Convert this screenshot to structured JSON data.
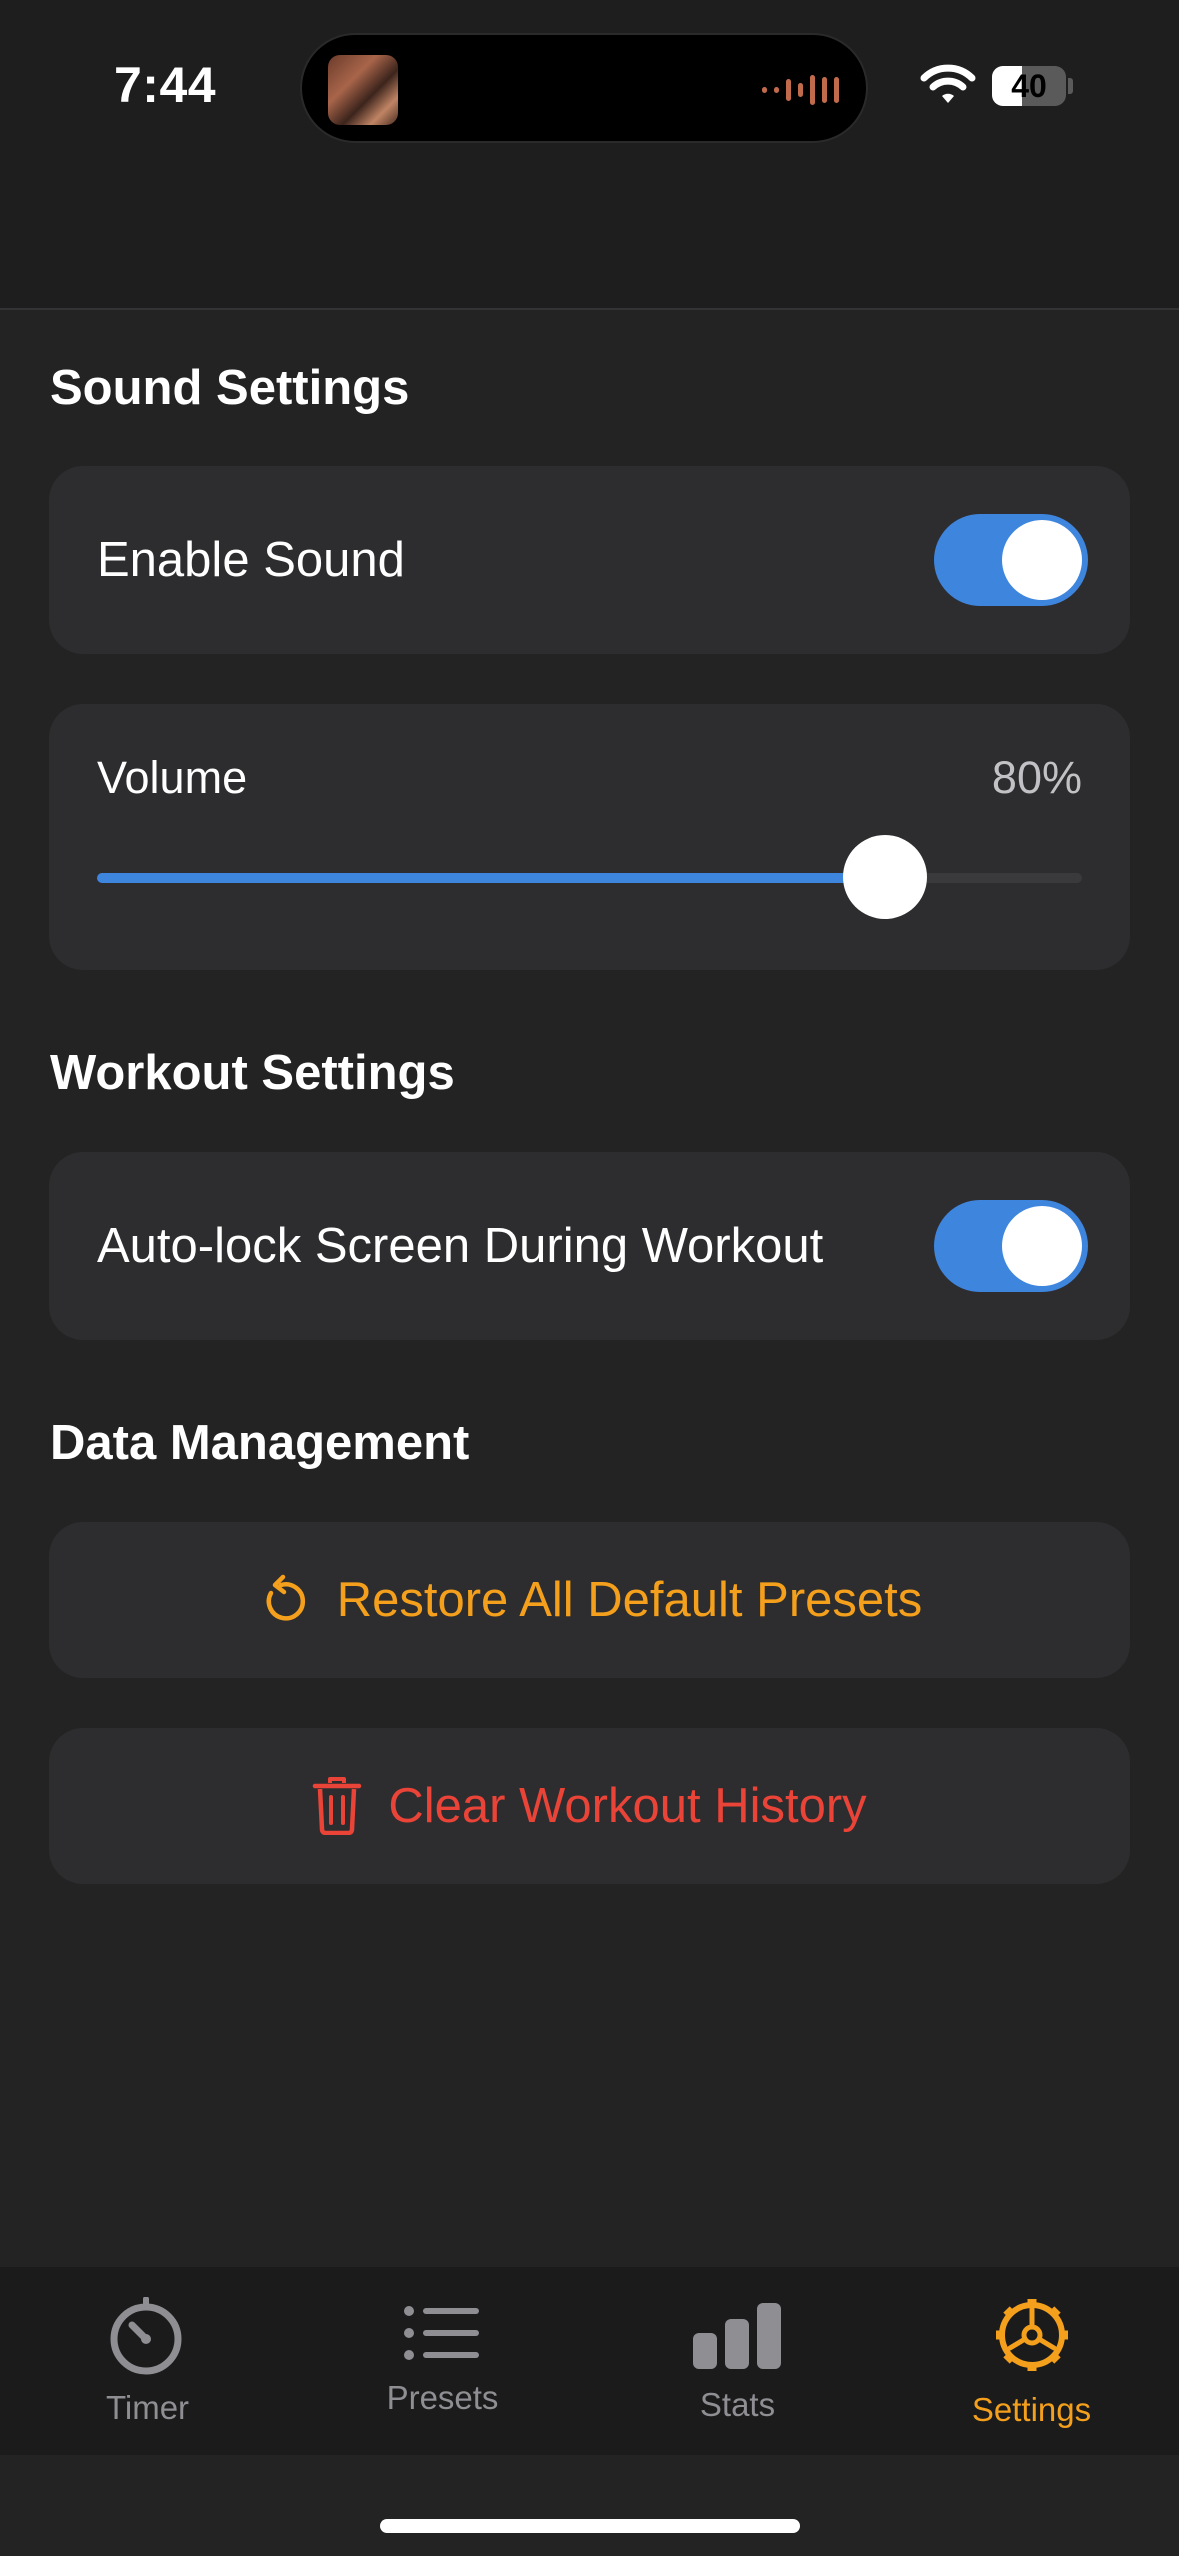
{
  "status_bar": {
    "time": "7:44",
    "battery_level": "40",
    "battery_fraction": 0.4
  },
  "sound_settings": {
    "title": "Sound Settings",
    "enable_sound": {
      "label": "Enable Sound",
      "on": true
    },
    "volume": {
      "label": "Volume",
      "value_text": "80%",
      "value": 0.8
    }
  },
  "workout_settings": {
    "title": "Workout Settings",
    "auto_lock": {
      "label": "Auto-lock Screen During Workout",
      "on": true
    }
  },
  "data_management": {
    "title": "Data Management",
    "restore_label": "Restore All Default Presets",
    "clear_label": "Clear Workout History"
  },
  "tabbar": {
    "tabs": [
      {
        "label": "Timer",
        "icon": "stopwatch-icon",
        "active": false
      },
      {
        "label": "Presets",
        "icon": "list-icon",
        "active": false
      },
      {
        "label": "Stats",
        "icon": "bar-chart-icon",
        "active": false
      },
      {
        "label": "Settings",
        "icon": "gear-icon",
        "active": true
      }
    ]
  },
  "colors": {
    "accent_blue": "#3e85de",
    "accent_orange": "#f4a01c",
    "destructive_red": "#ea4337",
    "inactive_gray": "#8e8e93"
  }
}
